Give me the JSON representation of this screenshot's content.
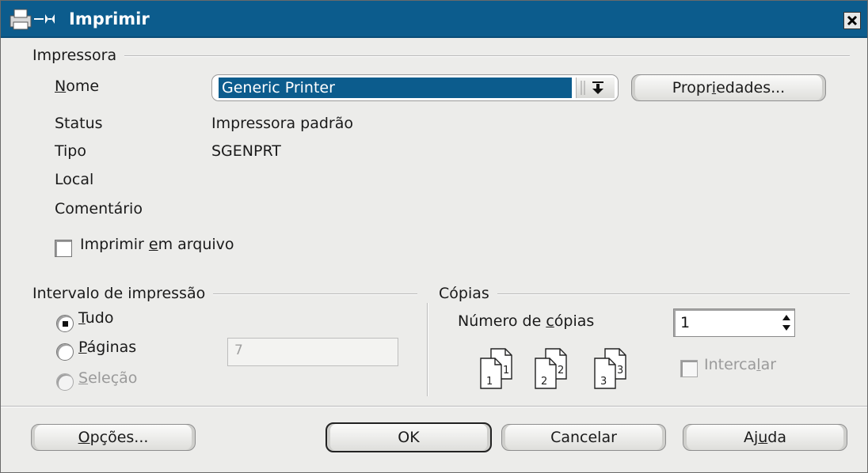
{
  "window": {
    "title": "Imprimir"
  },
  "printer_group": {
    "title": "Impressora",
    "name_label": {
      "before": "",
      "ul": "N",
      "after": "ome"
    },
    "name_value": "Generic Printer",
    "properties_button": {
      "before": "Propr",
      "ul": "i",
      "after": "edades..."
    },
    "status_label": "Status",
    "status_value": "Impressora padrão",
    "type_label": "Tipo",
    "type_value": "SGENPRT",
    "location_label": "Local",
    "comment_label": "Comentário",
    "print_to_file": {
      "before": "Imprimir ",
      "ul": "e",
      "after": "m arquivo",
      "checked": false
    }
  },
  "range_group": {
    "title": "Intervalo de impressão",
    "all": {
      "before": "",
      "ul": "T",
      "after": "udo",
      "checked": true
    },
    "pages": {
      "before": "",
      "ul": "P",
      "after": "áginas",
      "checked": false
    },
    "pages_value": "7",
    "selection": {
      "before": "",
      "ul": "S",
      "after": "eleção",
      "enabled": false
    }
  },
  "copies_group": {
    "title": "Cópias",
    "number_label": {
      "before": "Número de ",
      "ul": "c",
      "after": "ópias"
    },
    "number_value": "1",
    "collate": {
      "before": "Interca",
      "ul": "l",
      "after": "ar",
      "enabled": false
    },
    "collate_icon_numbers": [
      [
        "1",
        "1"
      ],
      [
        "2",
        "2"
      ],
      [
        "3",
        "3"
      ]
    ]
  },
  "buttons": {
    "options": {
      "before": "",
      "ul": "O",
      "after": "pções..."
    },
    "ok": "OK",
    "cancel": "Cancelar",
    "help": {
      "before": "Aj",
      "ul": "u",
      "after": "da"
    }
  }
}
